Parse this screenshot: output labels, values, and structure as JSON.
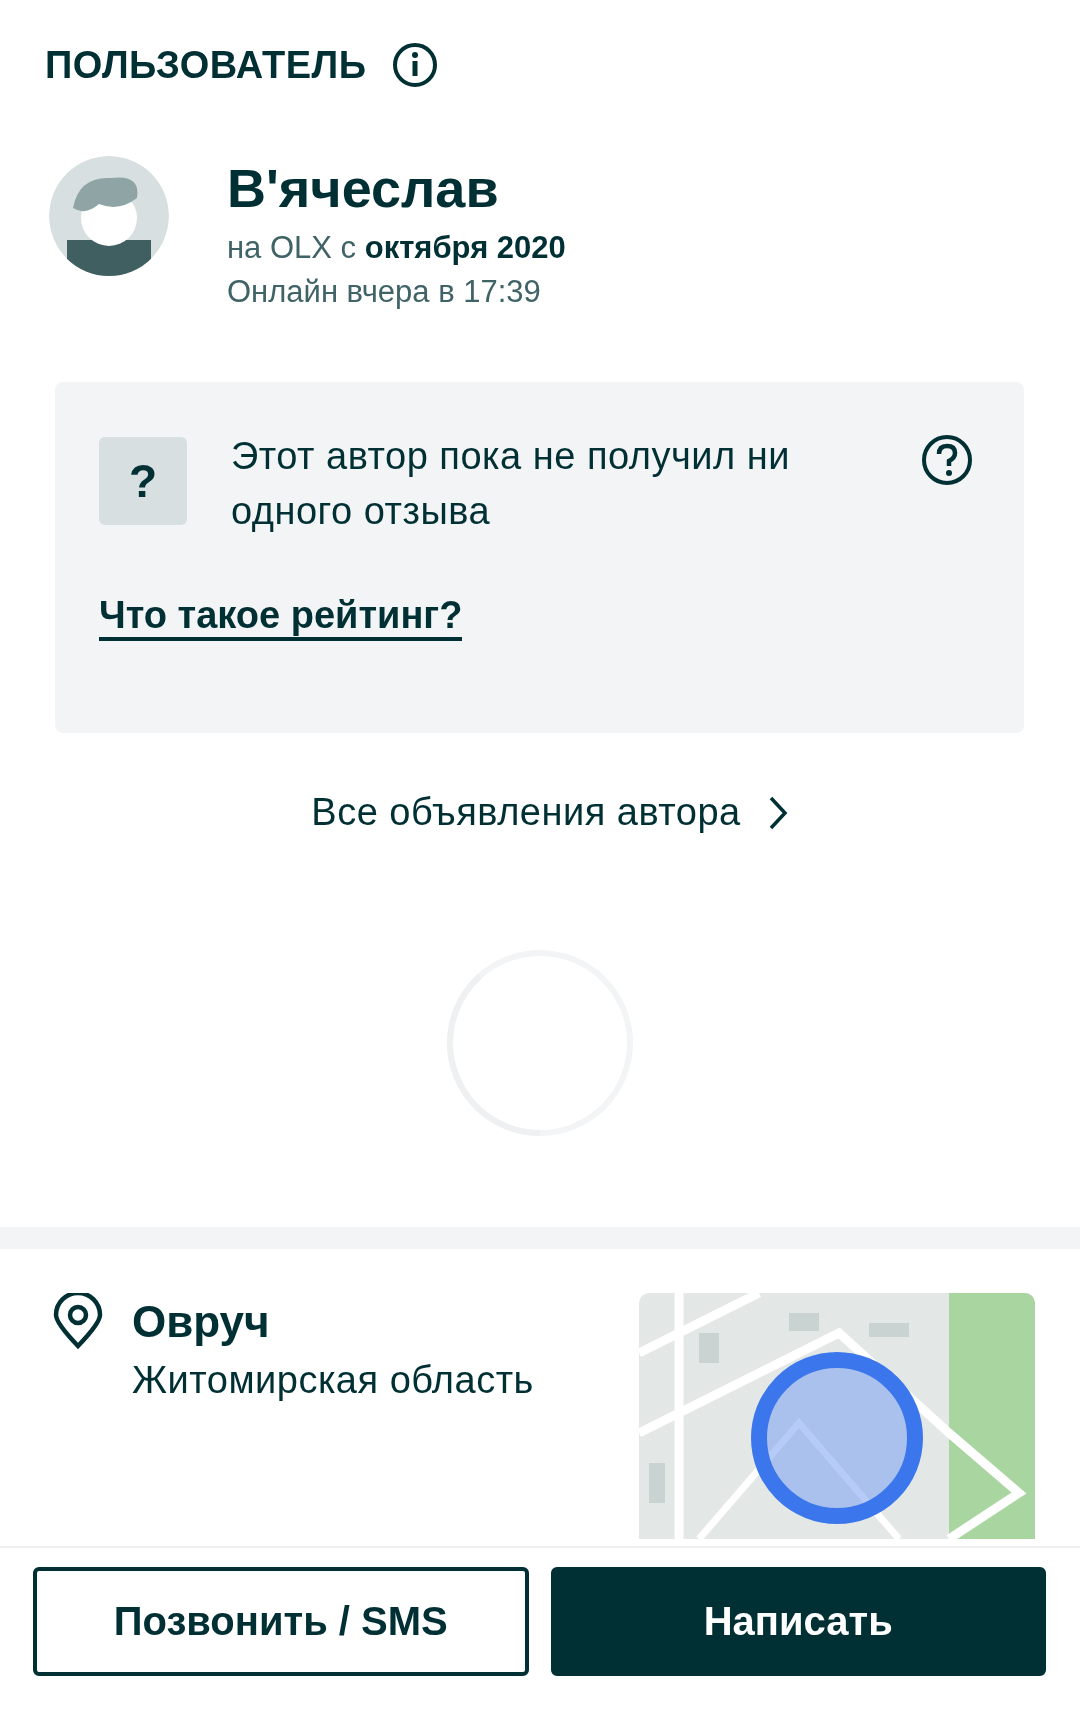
{
  "section_title": "ПОЛЬЗОВАТЕЛЬ",
  "user": {
    "name": "В'ячеслав",
    "member_since": "на OLX с **октября 2020**",
    "last_seen": "Онлайн вчера в 17:39"
  },
  "rating": {
    "icon": "?",
    "message": "Этот автор пока не получил ни одного отзыва",
    "link": "Что такое рейтинг?"
  },
  "all_ads_link": "Все объявления автора",
  "loading": true,
  "location": {
    "city": "Овруч",
    "region": "Житомирская область"
  },
  "buttons": [
    {
      "label": "Позвонить / SMS",
      "kind": "outline"
    },
    {
      "label": "Написать",
      "kind": "filled"
    }
  ]
}
